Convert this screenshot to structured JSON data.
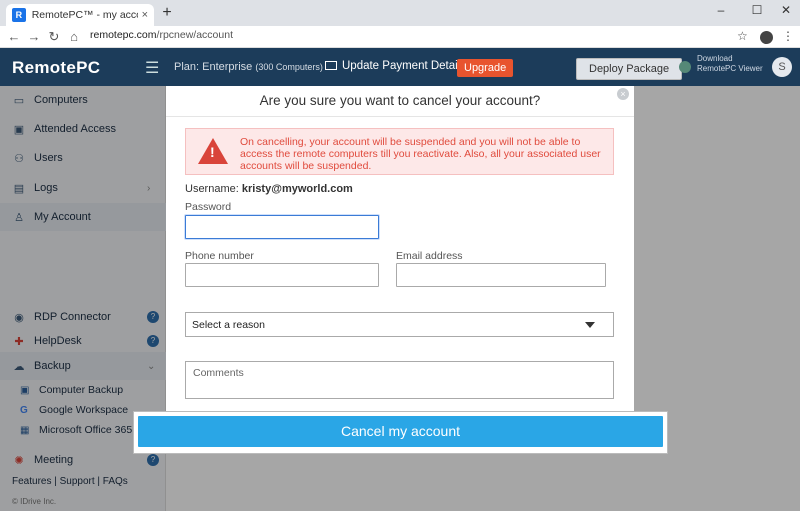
{
  "browser": {
    "tab_title": "RemotePC™ - my account inform",
    "tab_close": "×",
    "new_tab": "+",
    "url_host": "remotepc.com",
    "url_path": "/rpcnew/account",
    "back": "←",
    "forward": "→",
    "reload": "↻",
    "home": "⌂",
    "lock": "🔒",
    "star": "☆",
    "menu": "⋮",
    "minimize": "–",
    "maximize": "☐",
    "close": "✕"
  },
  "header": {
    "logo": "RemotePC",
    "plan": "Plan: Enterprise",
    "plan_detail": "(300 Computers)",
    "update_payment": "Update Payment Details",
    "upgrade": "Upgrade",
    "deploy": "Deploy Package",
    "download_line1": "Download",
    "download_line2": "RemotePC Viewer",
    "user_initial": "S"
  },
  "sidebar": {
    "items": [
      {
        "label": "Computers"
      },
      {
        "label": "Attended Access"
      },
      {
        "label": "Users"
      },
      {
        "label": "Logs"
      },
      {
        "label": "My Account"
      },
      {
        "label": "RDP Connector"
      },
      {
        "label": "HelpDesk"
      },
      {
        "label": "Backup"
      },
      {
        "label": "Meeting"
      }
    ],
    "backup_sub": [
      {
        "label": "Computer Backup"
      },
      {
        "label": "Google Workspace"
      },
      {
        "label": "Microsoft Office 365"
      }
    ],
    "footer_links": "Features   |   Support   |   FAQs",
    "copyright": "© IDrive Inc."
  },
  "modal": {
    "title": "Are you sure you want to cancel your account?",
    "close": "×",
    "warning": "On cancelling, your account will be suspended and you will not be able to access the remote computers till you reactivate. Also, all your associated user accounts will be suspended.",
    "username_label": "Username:",
    "username_value": "kristy@myworld.com",
    "password_label": "Password",
    "phone_label": "Phone number",
    "email_label": "Email address",
    "reason_placeholder": "Select a reason",
    "comments_placeholder": "Comments",
    "cancel_button": "Cancel my account"
  },
  "colors": {
    "header_bg": "#1c3c5a",
    "upgrade_bg": "#e8542e",
    "warning_text": "#e04b3d",
    "cancel_button_bg": "#2aa6e6"
  }
}
